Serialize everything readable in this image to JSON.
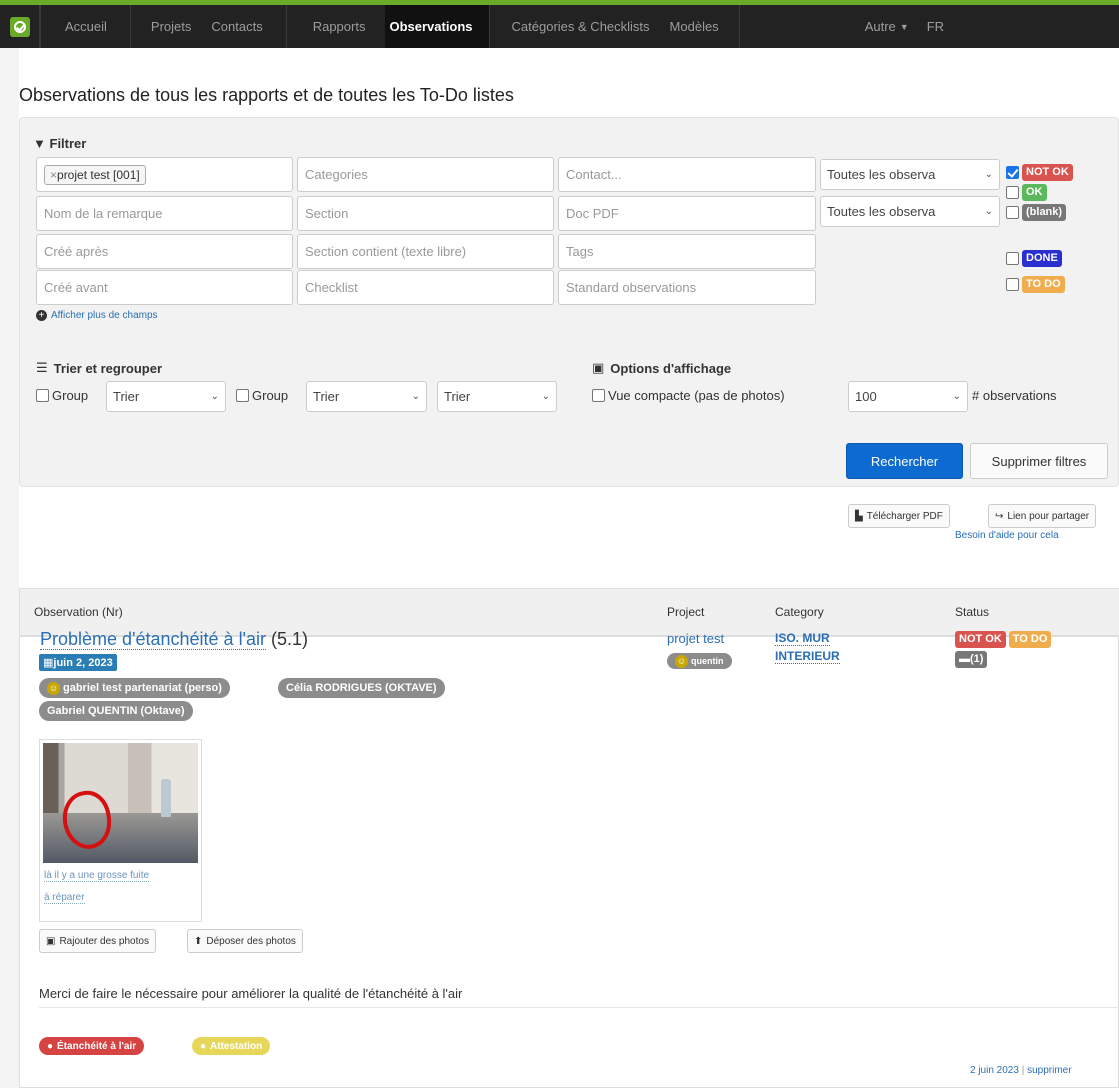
{
  "nav": {
    "items": [
      "Accueil",
      "Projets",
      "Contacts",
      "Rapports",
      "Observations",
      "Catégories & Checklists",
      "Modèles"
    ],
    "active": "Observations",
    "other": "Autre",
    "lang": "FR"
  },
  "page": {
    "title": "Observations de tous les rapports et de toutes les To-Do listes"
  },
  "filter": {
    "heading": "Filtrer",
    "project_token": "projet test [001]",
    "categories_ph": "Categories",
    "contact_ph": "Contact...",
    "remark_ph": "Nom de la remarque",
    "section_ph": "Section",
    "docpdf_ph": "Doc PDF",
    "created_after_ph": "Créé après",
    "section_contains_ph": "Section contient (texte libre)",
    "tags_ph": "Tags",
    "created_before_ph": "Créé avant",
    "checklist_ph": "Checklist",
    "standard_ph": "Standard observations",
    "select1": "Toutes les observa",
    "select2": "Toutes les observa",
    "show_more": "Afficher plus de champs",
    "statuses": [
      {
        "label": "NOT OK",
        "checked": true,
        "color": "#d9534f"
      },
      {
        "label": "OK",
        "checked": false,
        "color": "#5cb85c"
      },
      {
        "label": "(blank)",
        "checked": false,
        "color": "#777777"
      },
      {
        "label": "DONE",
        "checked": false,
        "color": "#2a2fd0"
      },
      {
        "label": "TO DO",
        "checked": false,
        "color": "#f0ad4e"
      }
    ]
  },
  "sort": {
    "heading": "Trier et regrouper",
    "group1": "Group",
    "sort1": "Trier",
    "group2": "Group",
    "sort2": "Trier",
    "sort3": "Trier"
  },
  "display": {
    "heading": "Options d'affichage",
    "compact": "Vue compacte (pas de photos)",
    "count": "100",
    "count_label": "# observations"
  },
  "buttons": {
    "search": "Rechercher",
    "clear": "Supprimer filtres",
    "pdf": "Télécharger PDF",
    "share": "Lien pour partager",
    "help": "Besoin d'aide pour cela"
  },
  "table": {
    "headers": [
      "Observation (Nr)",
      "Project",
      "Category",
      "Status"
    ]
  },
  "observation": {
    "title": "Problème d'étanchéité à l'air",
    "number": "(5.1)",
    "date": "juin 2, 2023",
    "people": [
      "gabriel test partenariat (perso)",
      "Célia RODRIGUES (OKTAVE)",
      "Gabriel QUENTIN (Oktave)"
    ],
    "photo_caption_1": "là il y a une grosse fuite",
    "photo_caption_2": "à réparer",
    "add_photos": "Rajouter des photos",
    "drop_photos": "Déposer des photos",
    "description": "Merci de faire le nécessaire pour améliorer la qualité de l'étanchéité à l'air",
    "tags": [
      "Étanchéité à l'air",
      "Attestation"
    ],
    "project": "projet test",
    "project_user": "quentin",
    "category_1": "ISO. MUR",
    "category_2": "INTERIEUR",
    "status_1": "NOT OK",
    "status_2": "TO DO",
    "comments": "(1)",
    "footer_date": "2 juin 2023",
    "footer_sep": "|",
    "footer_delete": "supprimer"
  }
}
